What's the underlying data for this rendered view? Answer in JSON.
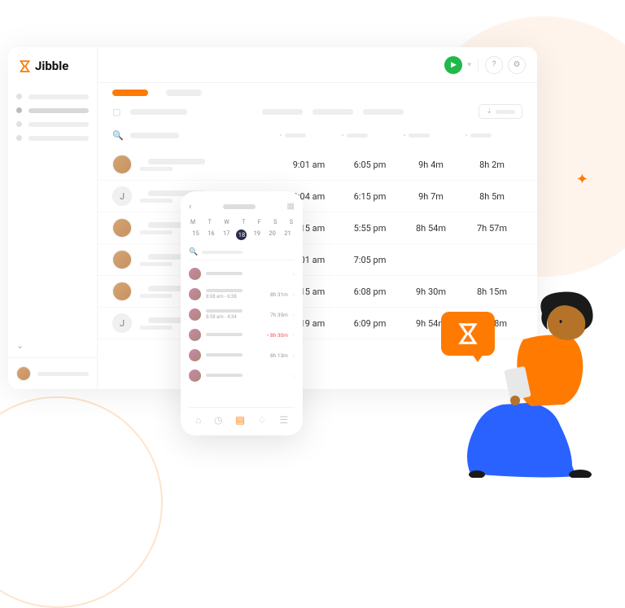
{
  "brand": {
    "name": "Jibble"
  },
  "rows": [
    {
      "avatar_type": "photo",
      "in": "9:01 am",
      "out": "6:05 pm",
      "dur1": "9h 4m",
      "dur2": "8h 2m"
    },
    {
      "avatar_type": "letter",
      "initial": "J",
      "in": "9:04 am",
      "out": "6:15 pm",
      "dur1": "9h 7m",
      "dur2": "8h 5m"
    },
    {
      "avatar_type": "photo",
      "in": "9:15 am",
      "out": "5:55 pm",
      "dur1": "8h 54m",
      "dur2": "7h 57m"
    },
    {
      "avatar_type": "photo",
      "in": "8:01 am",
      "out": "7:05 pm",
      "dur1": "",
      "dur2": ""
    },
    {
      "avatar_type": "photo",
      "in": "8:15 am",
      "out": "6:08 pm",
      "dur1": "9h 30m",
      "dur2": "8h 15m"
    },
    {
      "avatar_type": "letter",
      "initial": "J",
      "in": "8:19 am",
      "out": "6:09 pm",
      "dur1": "9h 54m",
      "dur2": "8h 18m"
    }
  ],
  "mobile": {
    "day_labels": [
      "M",
      "T",
      "W",
      "T",
      "F",
      "S",
      "S"
    ],
    "dates": [
      "15",
      "16",
      "17",
      "18",
      "19",
      "20",
      "21"
    ],
    "selected_index": 3,
    "list": [
      {
        "time": "",
        "dur": "",
        "over": false
      },
      {
        "time": "8:08 am - 6:38",
        "dur": "8h 31m",
        "over": false
      },
      {
        "time": "8:58 am - 4:34",
        "dur": "7h 35m",
        "over": false
      },
      {
        "time": "",
        "dur": "8h 30m",
        "over": true
      },
      {
        "time": "",
        "dur": "8h 13m",
        "over": false
      },
      {
        "time": "",
        "dur": "",
        "over": false
      }
    ]
  },
  "sidebar_user_avatar": "photo"
}
